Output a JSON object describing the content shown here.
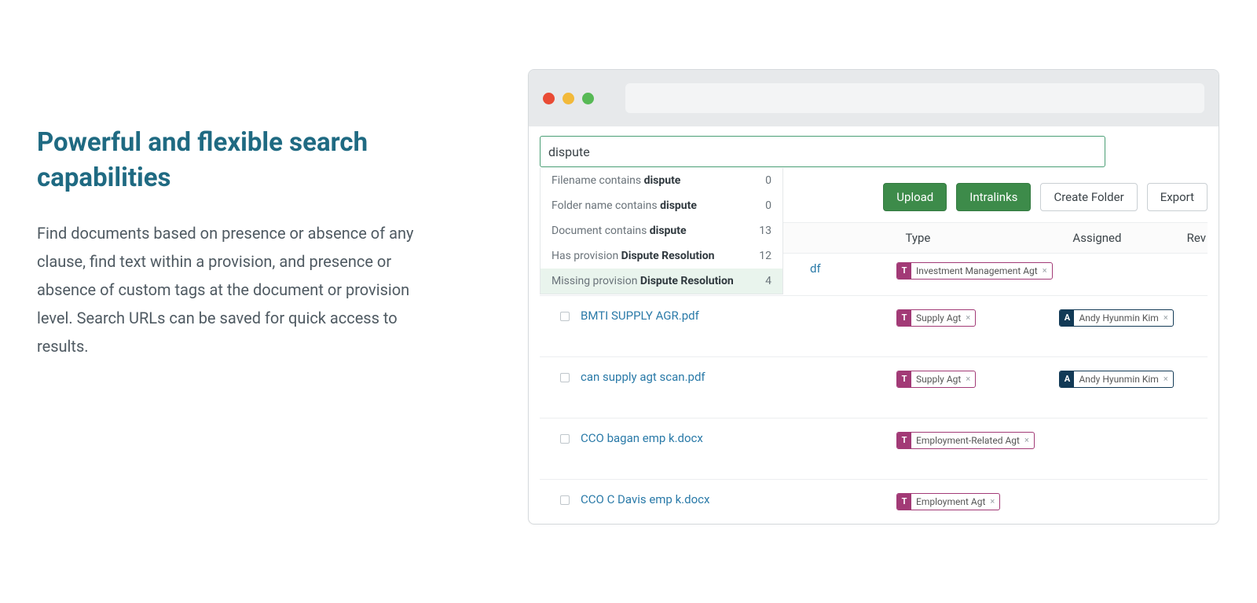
{
  "marketing": {
    "title": "Powerful and flexible search capabilities",
    "body": "Find documents based on presence or absence of any clause, find text within a provision, and presence or absence of custom tags at the document or provision level. Search URLs can be saved for quick access to results."
  },
  "colors": {
    "teal": "#1f6a82",
    "green_button": "#3d8b4a",
    "type_tag": "#a23a76",
    "person_tag": "#123a56",
    "link": "#2a7aa8",
    "search_border": "#4a9e75"
  },
  "app": {
    "search_value": "dispute",
    "suggestions": [
      {
        "prefix": "Filename contains ",
        "term": "dispute",
        "count": 0,
        "selected": false
      },
      {
        "prefix": "Folder name contains ",
        "term": "dispute",
        "count": 0,
        "selected": false
      },
      {
        "prefix": "Document contains ",
        "term": "dispute",
        "count": 13,
        "selected": false
      },
      {
        "prefix": "Has provision ",
        "term": "Dispute Resolution",
        "count": 12,
        "selected": false
      },
      {
        "prefix": "Missing provision ",
        "term": "Dispute Resolution",
        "count": 4,
        "selected": true
      }
    ],
    "toolbar": {
      "upload": "Upload",
      "intralinks": "Intralinks",
      "create_folder": "Create Folder",
      "export": "Export"
    },
    "columns": {
      "type": "Type",
      "assigned": "Assigned",
      "rev": "Rev"
    },
    "rows": [
      {
        "truncated": true,
        "name": "df",
        "type_tag": "Investment Management Agt",
        "assigned_tag": null
      },
      {
        "truncated": false,
        "name": "BMTI SUPPLY AGR.pdf",
        "type_tag": "Supply Agt",
        "assigned_tag": "Andy Hyunmin Kim"
      },
      {
        "truncated": false,
        "name": "can supply agt scan.pdf",
        "type_tag": "Supply Agt",
        "assigned_tag": "Andy Hyunmin Kim"
      },
      {
        "truncated": false,
        "name": "CCO bagan emp k.docx",
        "type_tag": "Employment-Related Agt",
        "assigned_tag": null
      },
      {
        "truncated": false,
        "name": "CCO C Davis emp k.docx",
        "type_tag": "Employment Agt",
        "assigned_tag": null
      }
    ],
    "tag_badges": {
      "type": "T",
      "person": "A",
      "close": "×"
    }
  }
}
